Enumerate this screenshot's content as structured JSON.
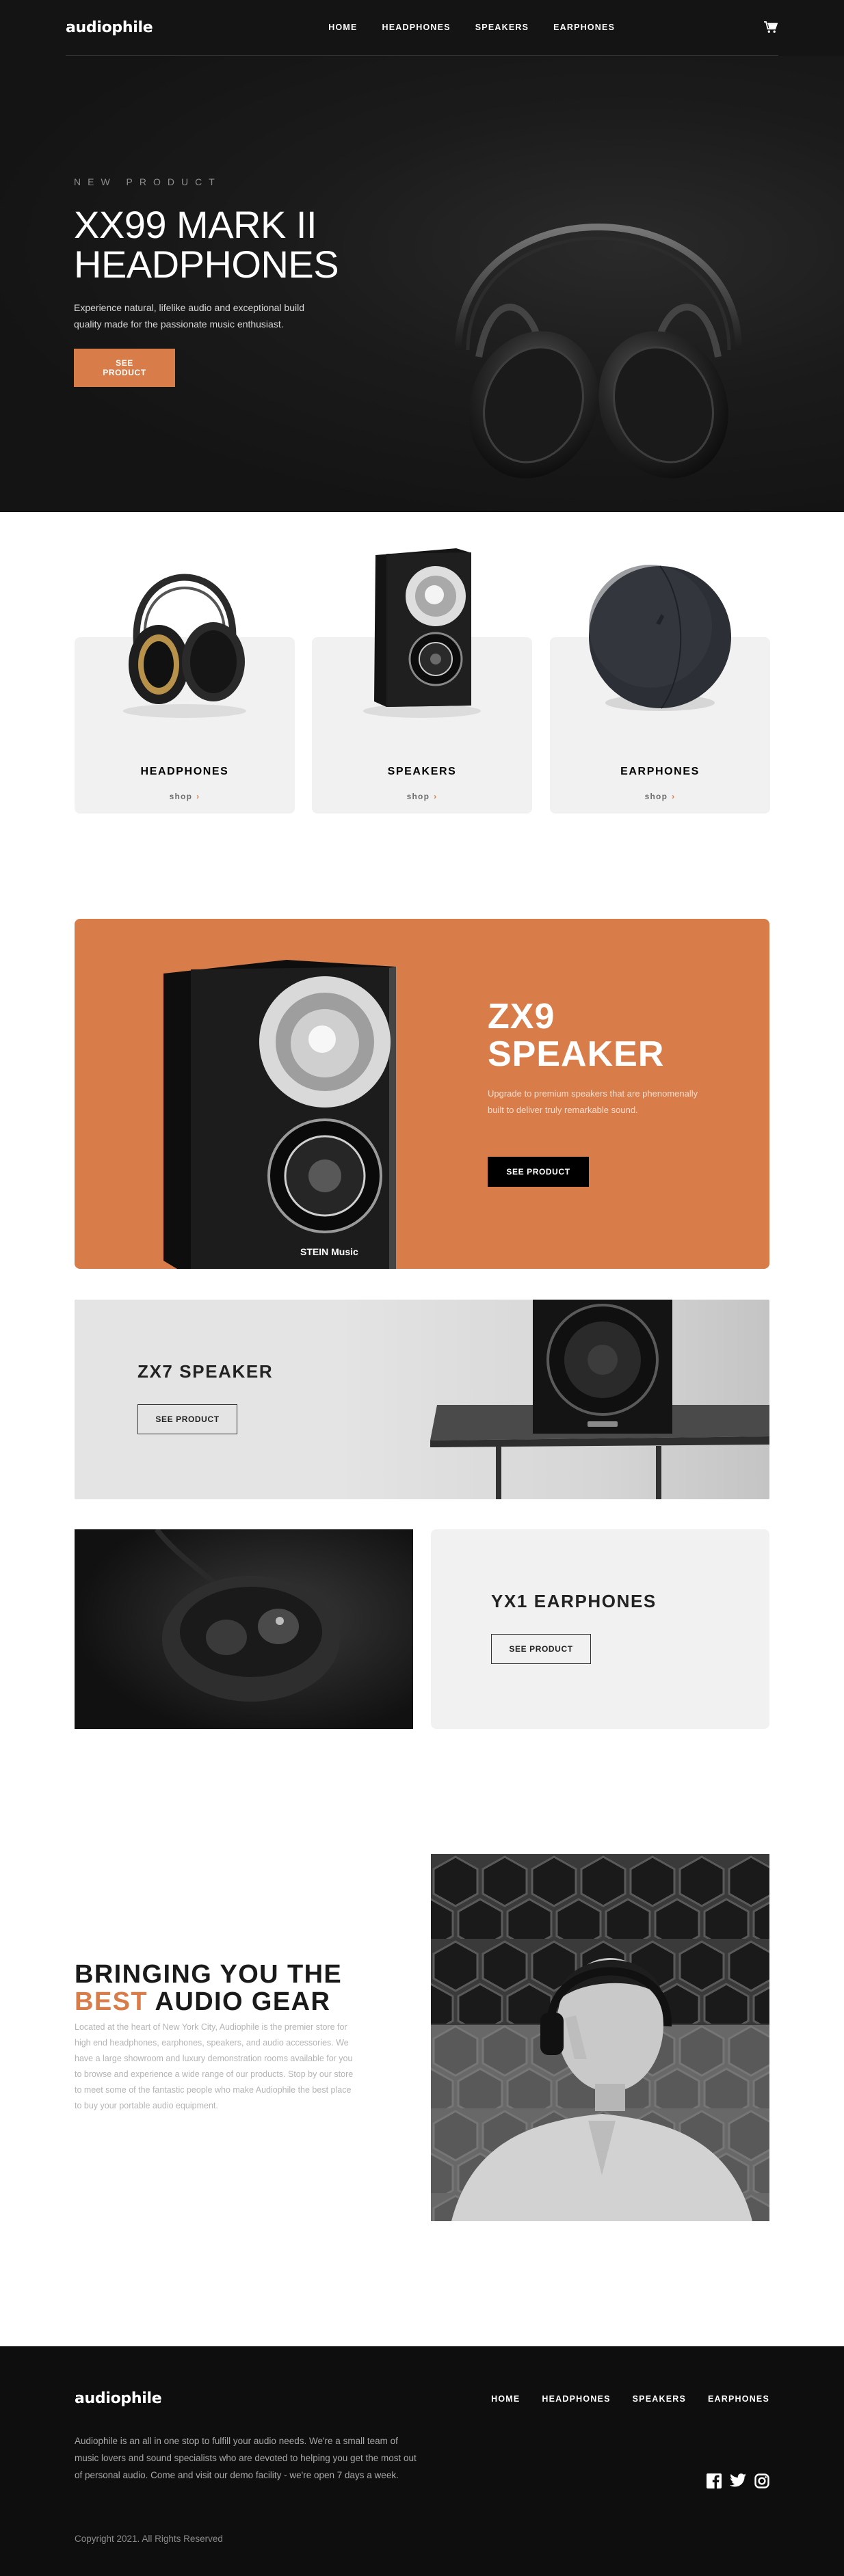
{
  "header": {
    "logo": "audiophile",
    "nav": [
      "HOME",
      "HEADPHONES",
      "SPEAKERS",
      "EARPHONES"
    ],
    "cart_icon": "cart-icon"
  },
  "hero": {
    "eyebrow": "NEW PRODUCT",
    "title_line1": "XX99 MARK II",
    "title_line2": "HEADPHONES",
    "description": "Experience natural, lifelike audio and exceptional build quality made for the passionate music enthusiast.",
    "button": "SEE PRODUCT"
  },
  "categories": [
    {
      "name": "HEADPHONES",
      "shop": "shop",
      "icon": "chevron-right-icon"
    },
    {
      "name": "SPEAKERS",
      "shop": "shop",
      "icon": "chevron-right-icon"
    },
    {
      "name": "EARPHONES",
      "shop": "shop",
      "icon": "chevron-right-icon"
    }
  ],
  "zx9": {
    "title_line1": "ZX9",
    "title_line2": "SPEAKER",
    "description": "Upgrade to premium speakers that are phenomenally built to deliver truly remarkable sound.",
    "button": "SEE PRODUCT",
    "brand_mark": "STEIN Music"
  },
  "zx7": {
    "title": "ZX7 SPEAKER",
    "button": "SEE PRODUCT"
  },
  "yx1": {
    "title": "YX1 EARPHONES",
    "button": "SEE PRODUCT"
  },
  "about": {
    "title_part1": "BRINGING YOU THE",
    "title_accent": "BEST",
    "title_part2": "AUDIO GEAR",
    "description": "Located at the heart of New York City, Audiophile is the premier store for high end headphones, earphones, speakers, and audio accessories. We have a large showroom and luxury demonstration rooms available for you to browse and experience a wide range of our products. Stop by our store to meet some of the fantastic people who make Audiophile the best place to buy your portable audio equipment."
  },
  "footer": {
    "logo": "audiophile",
    "nav": [
      "HOME",
      "HEADPHONES",
      "SPEAKERS",
      "EARPHONES"
    ],
    "description": "Audiophile is an all in one stop to fulfill your audio needs. We're a small team of music lovers and sound specialists who are devoted to helping you get the most out of personal audio. Come and visit our demo facility - we're open 7 days a week.",
    "social": [
      "facebook-icon",
      "twitter-icon",
      "instagram-icon"
    ],
    "copyright": "Copyright 2021. All Rights Reserved"
  },
  "colors": {
    "accent": "#D87D4A",
    "dark": "#141414",
    "light": "#F1F1F1"
  }
}
